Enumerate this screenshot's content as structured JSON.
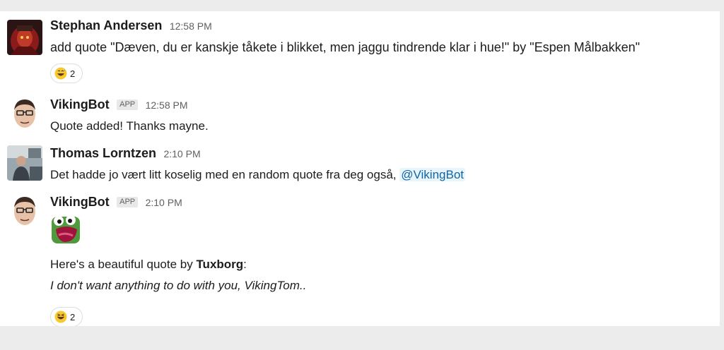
{
  "messages": [
    {
      "author": "Stephan Andersen",
      "time": "12:58 PM",
      "text": "add quote \"Dæven, du er kanskje tåkete i blikket, men jaggu tindrende klar i hue!\" by \"Espen Målbakken\"",
      "reaction_count": "2",
      "reaction_icon": "grinning-sweat-emoji-icon"
    },
    {
      "author": "VikingBot",
      "badge": "APP",
      "time": "12:58 PM",
      "text": "Quote added! Thanks mayne."
    },
    {
      "author": "Thomas Lorntzen",
      "time": "2:10 PM",
      "text_before": "Det hadde jo vært litt koselig med en random quote fra deg også, ",
      "mention": "@VikingBot"
    },
    {
      "author": "VikingBot",
      "badge": "APP",
      "time": "2:10 PM",
      "line1_prefix": "Here's a beautiful quote by ",
      "line1_name": "Tuxborg",
      "line1_suffix": ":",
      "quote": "I don't want anything to do with you, VikingTom..",
      "reaction_count": "2",
      "reaction_icon": "laughing-emoji-icon",
      "custom_emoji": "pepe-shouting-emoji-icon"
    }
  ],
  "colors": {
    "background": "#ececec",
    "panel": "#ffffff",
    "mention_text": "#1264a3",
    "mention_bg": "#e8f5fa"
  }
}
